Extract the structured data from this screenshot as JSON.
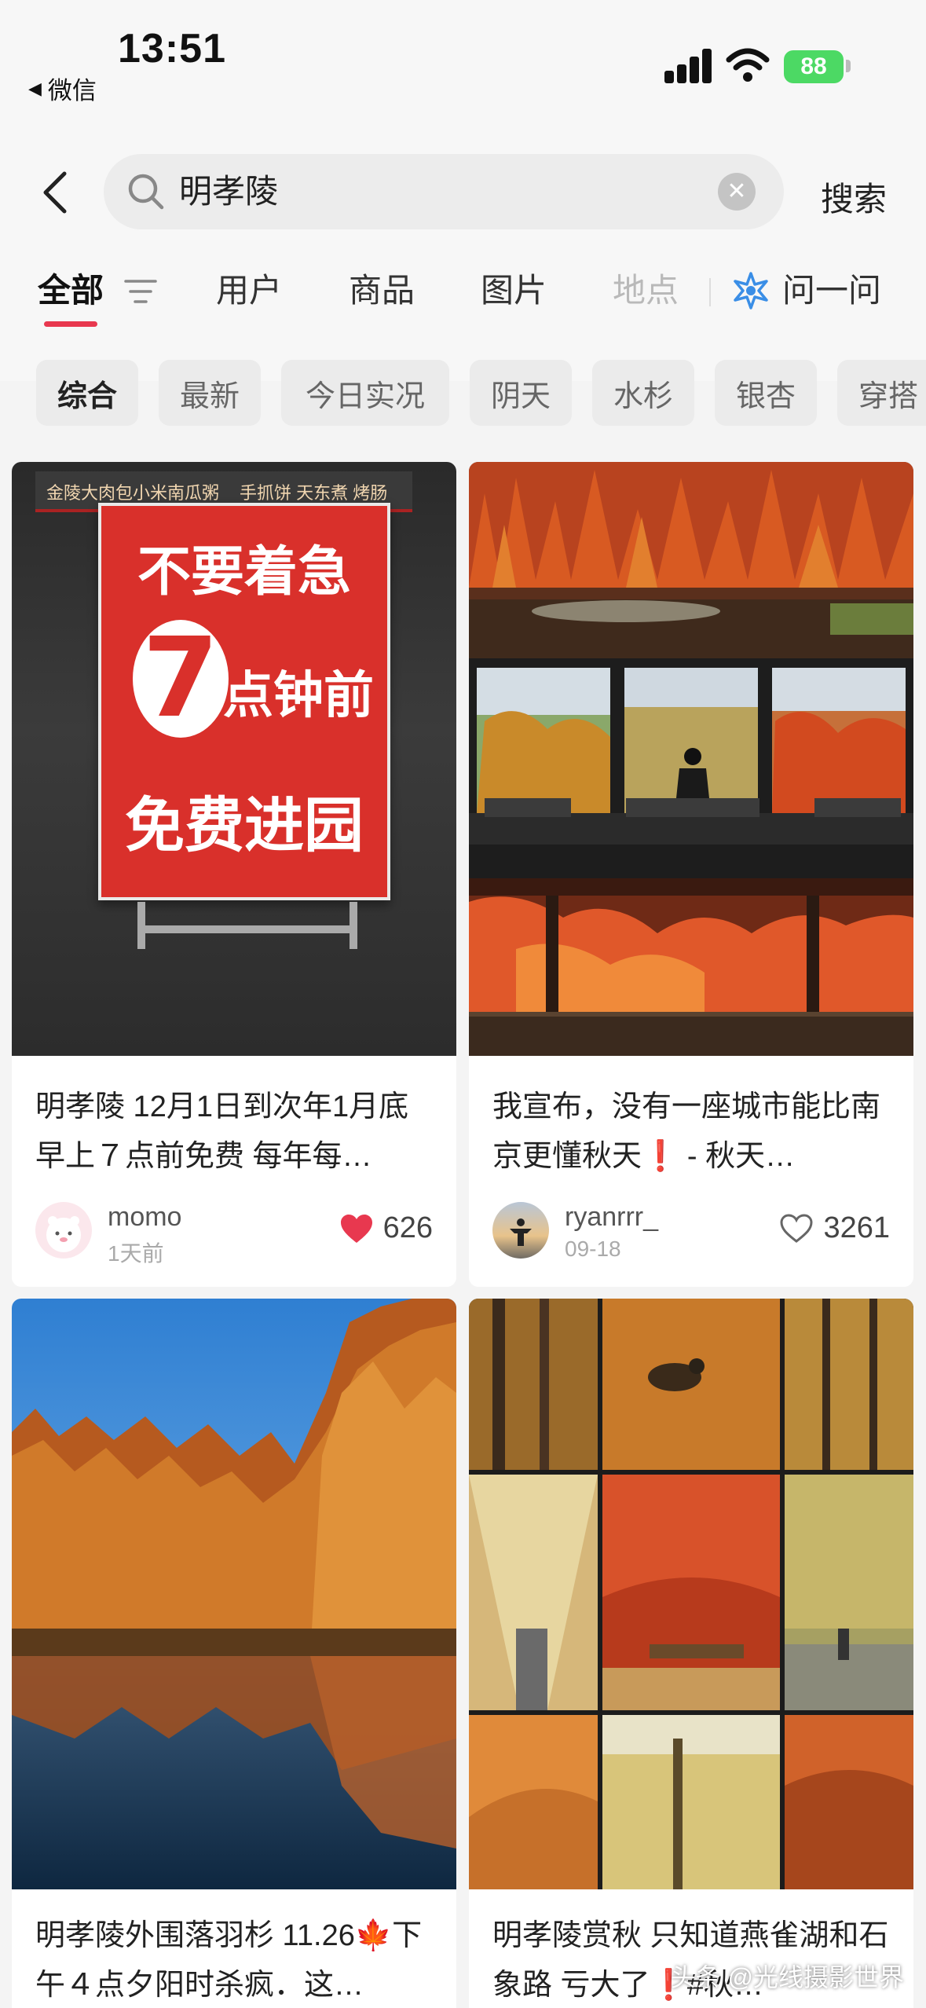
{
  "status_bar": {
    "time": "13:51",
    "back_app": "微信",
    "battery": "88"
  },
  "search": {
    "query": "明孝陵",
    "submit_label": "搜索"
  },
  "tabs": [
    {
      "label": "全部",
      "active": true
    },
    {
      "label": "用户"
    },
    {
      "label": "商品"
    },
    {
      "label": "图片"
    },
    {
      "label": "地点"
    },
    {
      "label": "问一问"
    }
  ],
  "chips": [
    "综合",
    "最新",
    "今日实况",
    "阴天",
    "水杉",
    "银杏",
    "穿搭"
  ],
  "sign": {
    "shop_text_1": "金陵大肉包小米南瓜粥",
    "shop_text_2": "手抓饼 天东煮 烤肠",
    "line1": "不要着急",
    "number": "7",
    "line2": "点钟前",
    "line3": "免费进园"
  },
  "feed": [
    {
      "title": "明孝陵 12月1日到次年1月底早上７点前免费 每年每…",
      "author": "momo",
      "time": "1天前",
      "likes": "626",
      "liked": true
    },
    {
      "title": "我宣布，没有一座城市能比南京更懂秋天❗️ - 秋天…",
      "author": "ryanrrr_",
      "time": "09-18",
      "likes": "3261",
      "liked": false
    },
    {
      "title": "明孝陵外围落羽杉 11.26🍁下午４点夕阳时杀疯．这…"
    },
    {
      "title": "明孝陵赏秋 只知道燕雀湖和石象路 亏大了❗️#秋…"
    }
  ],
  "watermark": "头条 @光线摄影世界",
  "colors": {
    "accent": "#e8384f",
    "battery": "#4cd964",
    "ask_icon": "#3a8ee6"
  }
}
